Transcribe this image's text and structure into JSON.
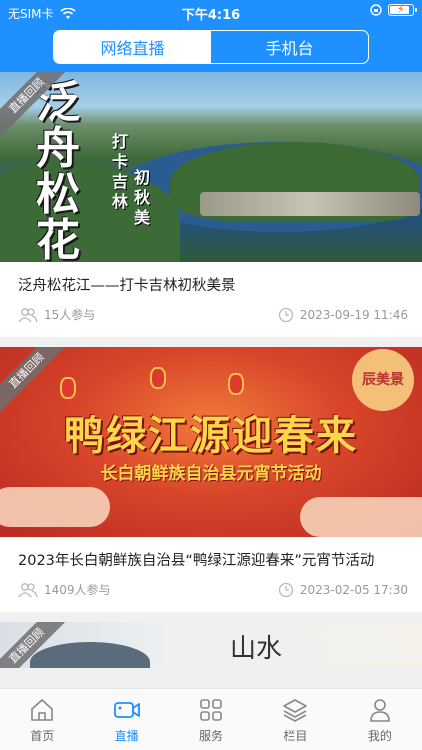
{
  "status": {
    "carrier": "无SIM卡",
    "time": "下午4:16"
  },
  "segments": {
    "left": "网络直播",
    "right": "手机台"
  },
  "ribbon_text": "直播回顾",
  "cards": [
    {
      "image_title": "泛舟松花江",
      "image_subtitle_a": "打卡吉林",
      "image_subtitle_b": "初秋美",
      "title": "泛舟松花江——打卡吉林初秋美景",
      "participants": "15人参与",
      "datetime": "2023-09-19 11:46"
    },
    {
      "image_title": "鸭绿江源迎春来",
      "image_subtitle": "长白朝鲜族自治县元宵节活动",
      "image_badge": "辰美景",
      "title": "2023年长白朝鲜族自治县“鸭绿江源迎春来”元宵节活动",
      "participants": "1409人参与",
      "datetime": "2023-02-05 17:30"
    },
    {
      "image_text": "山水"
    }
  ],
  "tabbar": [
    {
      "label": "首页",
      "icon": "home-icon"
    },
    {
      "label": "直播",
      "icon": "video-camera-icon"
    },
    {
      "label": "服务",
      "icon": "grid-icon"
    },
    {
      "label": "栏目",
      "icon": "layers-icon"
    },
    {
      "label": "我的",
      "icon": "user-icon"
    }
  ],
  "colors": {
    "accent": "#1e90ff",
    "tab_inactive": "#666666",
    "meta": "#999999"
  }
}
